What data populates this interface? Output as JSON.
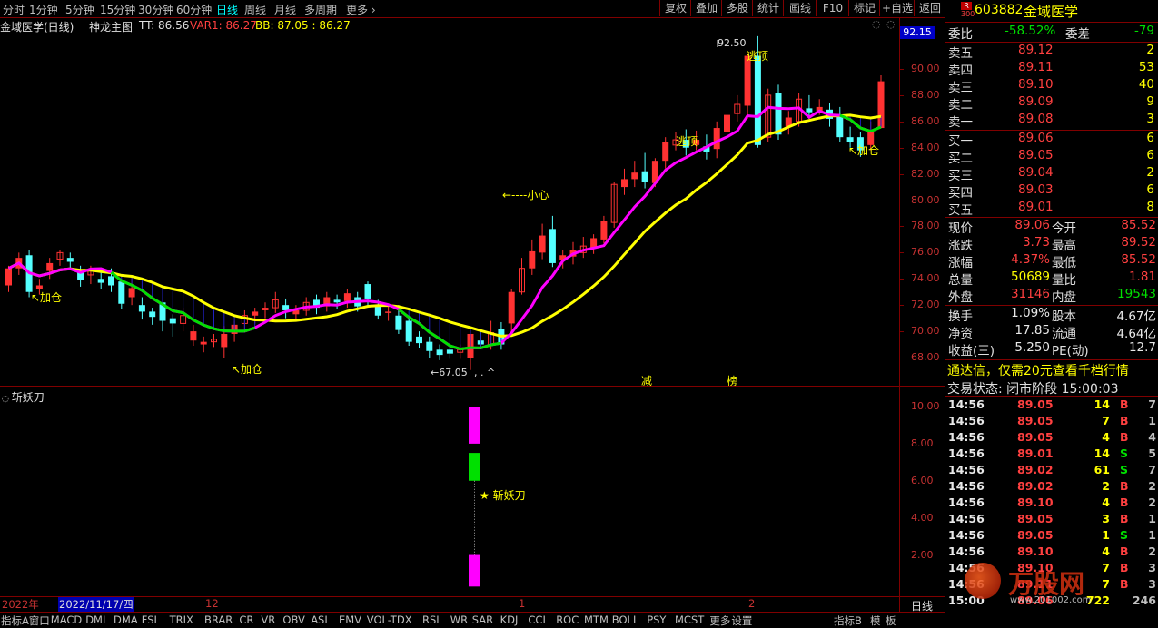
{
  "toolbar": {
    "periods": [
      "分时",
      "1分钟",
      "5分钟",
      "15分钟",
      "30分钟",
      "60分钟",
      "日线",
      "周线",
      "月线",
      "多周期",
      "更多"
    ],
    "active_period": "日线",
    "right_buttons": [
      "复权",
      "叠加",
      "多股",
      "统计",
      "画线",
      "F10",
      "标记",
      "+自选",
      "返回"
    ]
  },
  "chart_header": {
    "title": "金域医学(日线)",
    "indicator_name": "神龙主图",
    "tt": "TT: 86.56",
    "var1": "VAR1: 86.27",
    "bb": "BB: 87.05 : 86.27",
    "price_tag": "92.15"
  },
  "price_axis": [
    "90.00",
    "88.00",
    "86.00",
    "84.00",
    "82.00",
    "80.00",
    "78.00",
    "76.00",
    "74.00",
    "72.00",
    "70.00",
    "68.00"
  ],
  "sub_axis": [
    "10.00",
    "8.00",
    "6.00",
    "4.00",
    "2.00"
  ],
  "annotations": {
    "add1": "↖加仓",
    "add2": "↖加仓",
    "add3": "↖加仓",
    "escape1": "逃顶",
    "escape2": "逃顶",
    "careful": "←----小心",
    "high": "92.50",
    "low": "←67.05",
    "jian": "减",
    "bang": "榜",
    "dot_text": ", . ^"
  },
  "sub_indicator": {
    "name": "斩妖刀",
    "star_label": "★ 斩妖刀"
  },
  "date_axis": {
    "year": "2022年",
    "cursor_date": "2022/11/17/四",
    "m12": "12",
    "m1": "1",
    "m2": "2",
    "period": "日线"
  },
  "bottom_tabs": [
    "指标A",
    "窗口",
    "MACD",
    "DMI",
    "DMA",
    "FSL",
    "TRIX",
    "BRAR",
    "CR",
    "VR",
    "OBV",
    "ASI",
    "EMV",
    "VOL-TDX",
    "RSI",
    "WR",
    "SAR",
    "KDJ",
    "CCI",
    "ROC",
    "MTM",
    "BOLL",
    "PSY",
    "MCST",
    "更多",
    "设置"
  ],
  "bottom_right": [
    "指标B",
    "模",
    "板"
  ],
  "quote": {
    "code": "603882",
    "name": "金域医学",
    "rank_badge": "R",
    "rank_num": "300",
    "webi_label": "委比",
    "webi": "-58.52%",
    "weicha_label": "委差",
    "weicha": "-79",
    "asks": [
      {
        "label": "卖五",
        "price": "89.12",
        "vol": "2"
      },
      {
        "label": "卖四",
        "price": "89.11",
        "vol": "53"
      },
      {
        "label": "卖三",
        "price": "89.10",
        "vol": "40"
      },
      {
        "label": "卖二",
        "price": "89.09",
        "vol": "9"
      },
      {
        "label": "卖一",
        "price": "89.08",
        "vol": "3"
      }
    ],
    "bids": [
      {
        "label": "买一",
        "price": "89.06",
        "vol": "6"
      },
      {
        "label": "买二",
        "price": "89.05",
        "vol": "6"
      },
      {
        "label": "买三",
        "price": "89.04",
        "vol": "2"
      },
      {
        "label": "买四",
        "price": "89.03",
        "vol": "6"
      },
      {
        "label": "买五",
        "price": "89.01",
        "vol": "8"
      }
    ],
    "stats": [
      {
        "l1": "现价",
        "v1": "89.06",
        "l2": "今开",
        "v2": "85.52",
        "c1": "red",
        "c2": "red"
      },
      {
        "l1": "涨跌",
        "v1": "3.73",
        "l2": "最高",
        "v2": "89.52",
        "c1": "red",
        "c2": "red"
      },
      {
        "l1": "涨幅",
        "v1": "4.37%",
        "l2": "最低",
        "v2": "85.52",
        "c1": "red",
        "c2": "red"
      },
      {
        "l1": "总量",
        "v1": "50689",
        "l2": "量比",
        "v2": "1.81",
        "c1": "yellow",
        "c2": "red"
      },
      {
        "l1": "外盘",
        "v1": "31146",
        "l2": "内盘",
        "v2": "19543",
        "c1": "red",
        "c2": "green"
      },
      {
        "l1": "换手",
        "v1": "1.09%",
        "l2": "股本",
        "v2": "4.67亿",
        "c1": "white",
        "c2": "white"
      },
      {
        "l1": "净资",
        "v1": "17.85",
        "l2": "流通",
        "v2": "4.64亿",
        "c1": "white",
        "c2": "white"
      },
      {
        "l1": "收益(三)",
        "v1": "5.250",
        "l2": "PE(动)",
        "v2": "12.7",
        "c1": "white",
        "c2": "white"
      }
    ],
    "promo": "通达信，仅需20元查看千档行情",
    "status": "交易状态: 闭市阶段 15:00:03",
    "ticks": [
      {
        "t": "14:56",
        "p": "89.05",
        "v": "14",
        "s": "B",
        "n": "7"
      },
      {
        "t": "14:56",
        "p": "89.05",
        "v": "7",
        "s": "B",
        "n": "1"
      },
      {
        "t": "14:56",
        "p": "89.05",
        "v": "4",
        "s": "B",
        "n": "4"
      },
      {
        "t": "14:56",
        "p": "89.01",
        "v": "14",
        "s": "S",
        "n": "5"
      },
      {
        "t": "14:56",
        "p": "89.02",
        "v": "61",
        "s": "S",
        "n": "7"
      },
      {
        "t": "14:56",
        "p": "89.02",
        "v": "2",
        "s": "B",
        "n": "2"
      },
      {
        "t": "14:56",
        "p": "89.10",
        "v": "4",
        "s": "B",
        "n": "2"
      },
      {
        "t": "14:56",
        "p": "89.05",
        "v": "3",
        "s": "B",
        "n": "1"
      },
      {
        "t": "14:56",
        "p": "89.05",
        "v": "1",
        "s": "S",
        "n": "1"
      },
      {
        "t": "14:56",
        "p": "89.10",
        "v": "4",
        "s": "B",
        "n": "2"
      },
      {
        "t": "14:56",
        "p": "89.10",
        "v": "7",
        "s": "B",
        "n": "3"
      },
      {
        "t": "14:56",
        "p": "89.11",
        "v": "7",
        "s": "B",
        "n": "3"
      },
      {
        "t": "15:00",
        "p": "89.06",
        "v": "722",
        "s": "",
        "n": "246"
      }
    ],
    "watermark": "万股网",
    "watermark_url": "www.201002.com"
  },
  "colors": {
    "up": "#ff3232",
    "down": "#54ffff",
    "yellow": "#ffff00",
    "magenta": "#ff00ff",
    "green": "#00e000",
    "grid": "#800000"
  },
  "chart_data": {
    "type": "candlestick",
    "y_range": [
      67,
      93
    ],
    "candles": [
      [
        73.5,
        74.8,
        73.0,
        75.0
      ],
      [
        74.8,
        75.6,
        74.3,
        76.0
      ],
      [
        75.8,
        73.0,
        72.6,
        76.2
      ],
      [
        73.2,
        73.5,
        72.8,
        74.0
      ],
      [
        74.6,
        75.2,
        74.0,
        75.6
      ],
      [
        75.5,
        76.0,
        75.0,
        76.2
      ],
      [
        75.6,
        75.3,
        74.8,
        76.0
      ],
      [
        74.5,
        73.9,
        73.4,
        75.0
      ],
      [
        74.3,
        74.6,
        73.6,
        75.0
      ],
      [
        74.0,
        73.7,
        73.2,
        74.6
      ],
      [
        74.2,
        73.5,
        73.0,
        74.8
      ],
      [
        73.8,
        72.1,
        71.7,
        74.0
      ],
      [
        72.6,
        73.3,
        72.0,
        74.2
      ],
      [
        72.0,
        71.5,
        70.9,
        72.6
      ],
      [
        71.5,
        71.1,
        70.5,
        71.8
      ],
      [
        72.2,
        70.8,
        70.0,
        72.6
      ],
      [
        71.0,
        70.6,
        69.6,
        71.3
      ],
      [
        70.6,
        71.2,
        70.0,
        71.8
      ],
      [
        69.3,
        70.0,
        68.9,
        70.5
      ],
      [
        69.0,
        69.2,
        68.4,
        69.6
      ],
      [
        69.2,
        69.4,
        68.8,
        69.8
      ],
      [
        68.8,
        69.8,
        68.0,
        70.4
      ],
      [
        69.8,
        70.5,
        69.2,
        70.8
      ],
      [
        70.6,
        71.2,
        70.2,
        71.6
      ],
      [
        71.2,
        71.5,
        70.6,
        71.8
      ],
      [
        71.6,
        71.8,
        71.0,
        72.2
      ],
      [
        71.8,
        72.4,
        71.4,
        73.0
      ],
      [
        72.0,
        71.6,
        71.0,
        72.5
      ],
      [
        71.3,
        71.6,
        70.9,
        72.0
      ],
      [
        71.6,
        72.2,
        71.2,
        72.6
      ],
      [
        72.4,
        71.8,
        71.3,
        72.8
      ],
      [
        71.9,
        72.6,
        71.5,
        73.0
      ],
      [
        72.4,
        72.2,
        71.7,
        72.8
      ],
      [
        72.3,
        72.9,
        71.8,
        73.2
      ],
      [
        72.6,
        71.9,
        71.5,
        73.0
      ],
      [
        73.6,
        72.5,
        71.8,
        73.8
      ],
      [
        72.0,
        71.2,
        70.9,
        72.4
      ],
      [
        71.4,
        71.5,
        70.8,
        72.0
      ],
      [
        71.2,
        70.1,
        69.8,
        72.0
      ],
      [
        70.8,
        69.2,
        68.9,
        71.2
      ],
      [
        69.6,
        69.1,
        68.7,
        70.0
      ],
      [
        69.2,
        68.5,
        68.0,
        69.6
      ],
      [
        68.6,
        68.2,
        67.8,
        69.0
      ],
      [
        68.6,
        68.3,
        67.9,
        69.0
      ],
      [
        68.4,
        68.6,
        67.9,
        69.0
      ],
      [
        68.0,
        69.8,
        67.05,
        70.0
      ],
      [
        69.3,
        69.0,
        68.8,
        70.0
      ],
      [
        69.0,
        69.9,
        68.6,
        70.8
      ],
      [
        70.2,
        69.0,
        68.6,
        70.7
      ],
      [
        70.6,
        73.0,
        70.0,
        73.2
      ],
      [
        73.0,
        74.8,
        72.8,
        75.6
      ],
      [
        74.8,
        76.1,
        74.3,
        77.0
      ],
      [
        76.0,
        77.3,
        75.5,
        78.2
      ],
      [
        77.8,
        75.2,
        74.9,
        78.8
      ],
      [
        75.4,
        75.8,
        74.8,
        76.2
      ],
      [
        75.7,
        76.2,
        75.1,
        76.8
      ],
      [
        76.0,
        76.5,
        75.6,
        77.2
      ],
      [
        76.4,
        77.1,
        75.9,
        77.4
      ],
      [
        77.0,
        78.4,
        76.7,
        78.8
      ],
      [
        78.3,
        81.2,
        77.9,
        81.4
      ],
      [
        81.0,
        81.6,
        80.4,
        82.4
      ],
      [
        81.6,
        82.1,
        81.0,
        83.0
      ],
      [
        82.2,
        81.4,
        80.9,
        83.6
      ],
      [
        81.3,
        83.0,
        81.0,
        83.2
      ],
      [
        83.0,
        84.4,
        82.4,
        84.8
      ],
      [
        84.2,
        84.6,
        83.8,
        85.2
      ],
      [
        84.6,
        84.0,
        83.4,
        85.4
      ],
      [
        84.2,
        84.6,
        83.8,
        85.3
      ],
      [
        84.1,
        83.7,
        83.1,
        85.0
      ],
      [
        83.9,
        85.5,
        83.2,
        86.0
      ],
      [
        85.2,
        86.5,
        84.8,
        87.2
      ],
      [
        86.6,
        87.3,
        86.0,
        88.0
      ],
      [
        87.2,
        91.0,
        86.2,
        91.2
      ],
      [
        91.0,
        84.2,
        84.0,
        92.5
      ],
      [
        84.8,
        88.0,
        84.4,
        88.5
      ],
      [
        88.2,
        85.0,
        84.6,
        88.8
      ],
      [
        85.6,
        86.3,
        85.0,
        86.8
      ],
      [
        86.0,
        87.7,
        85.6,
        88.2
      ],
      [
        87.0,
        86.7,
        86.2,
        88.0
      ],
      [
        86.8,
        87.1,
        86.5,
        87.7
      ],
      [
        86.9,
        86.2,
        85.6,
        87.4
      ],
      [
        86.4,
        84.8,
        84.4,
        87.1
      ],
      [
        84.8,
        84.4,
        84.0,
        85.6
      ],
      [
        84.8,
        83.8,
        83.3,
        85.2
      ],
      [
        84.2,
        85.2,
        83.8,
        86.0
      ],
      [
        85.5,
        89.06,
        85.52,
        89.52
      ]
    ]
  }
}
